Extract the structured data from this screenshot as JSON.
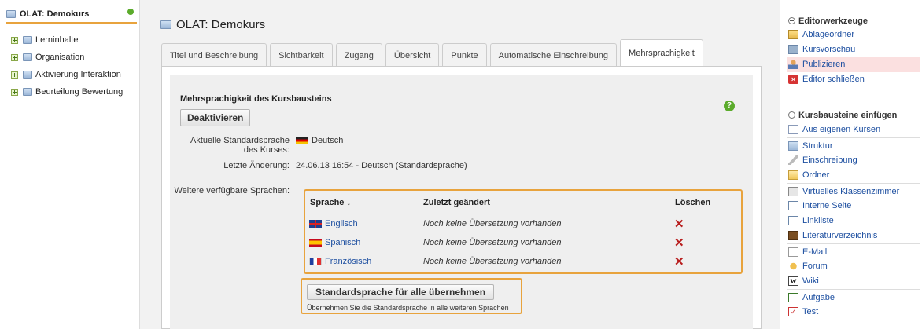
{
  "tree": {
    "root": "OLAT: Demokurs",
    "items": [
      "Lerninhalte",
      "Organisation",
      "Aktivierung Interaktion",
      "Beurteilung Bewertung"
    ]
  },
  "main": {
    "title": "OLAT: Demokurs",
    "tabs": [
      "Titel und Beschreibung",
      "Sichtbarkeit",
      "Zugang",
      "Übersicht",
      "Punkte",
      "Automatische Einschreibung",
      "Mehrsprachigkeit"
    ],
    "active_tab": "Mehrsprachigkeit",
    "section_title": "Mehrsprachigkeit des Kursbausteins",
    "deactivate_label": "Deaktivieren",
    "help_glyph": "?",
    "std_lang_label_line1": "Aktuelle Standardsprache",
    "std_lang_label_line2": "des Kurses:",
    "std_lang_value": "Deutsch",
    "last_change_label": "Letzte Änderung:",
    "last_change_value": "24.06.13 16:54 - Deutsch (Standardsprache)",
    "more_langs_label": "Weitere verfügbare Sprachen:",
    "table": {
      "col_language": "Sprache ↓",
      "col_changed": "Zuletzt geändert",
      "col_delete": "Löschen",
      "rows": [
        {
          "lang": "Englisch",
          "status": "Noch keine Übersetzung vorhanden",
          "flag": "gb"
        },
        {
          "lang": "Spanisch",
          "status": "Noch keine Übersetzung vorhanden",
          "flag": "es"
        },
        {
          "lang": "Französisch",
          "status": "Noch keine Übersetzung vorhanden",
          "flag": "fr"
        }
      ],
      "delete_glyph": "✕"
    },
    "apply_std_label": "Standardsprache für alle übernehmen",
    "apply_std_hint": "Übernehmen Sie die Standardsprache in alle weiteren Sprachen"
  },
  "right": {
    "editor_tools_title": "Editorwerkzeuge",
    "editor_tools": [
      "Ablageordner",
      "Kursvorschau",
      "Publizieren",
      "Editor schließen"
    ],
    "insert_title": "Kursbausteine einfügen",
    "insert_items": [
      "Aus eigenen Kursen",
      "Struktur",
      "Einschreibung",
      "Ordner",
      "Virtuelles Klassenzimmer",
      "Interne Seite",
      "Linkliste",
      "Literaturverzeichnis",
      "E-Mail",
      "Forum",
      "Wiki",
      "Aufgabe",
      "Test"
    ],
    "close_glyph": "×",
    "wiki_glyph": "W",
    "test_glyph": "✓"
  },
  "colors": {
    "accent_orange": "#e8a33d",
    "link_blue": "#1d4fa0",
    "delete_red": "#b81d1d",
    "highlight": "#fbe0e0"
  }
}
